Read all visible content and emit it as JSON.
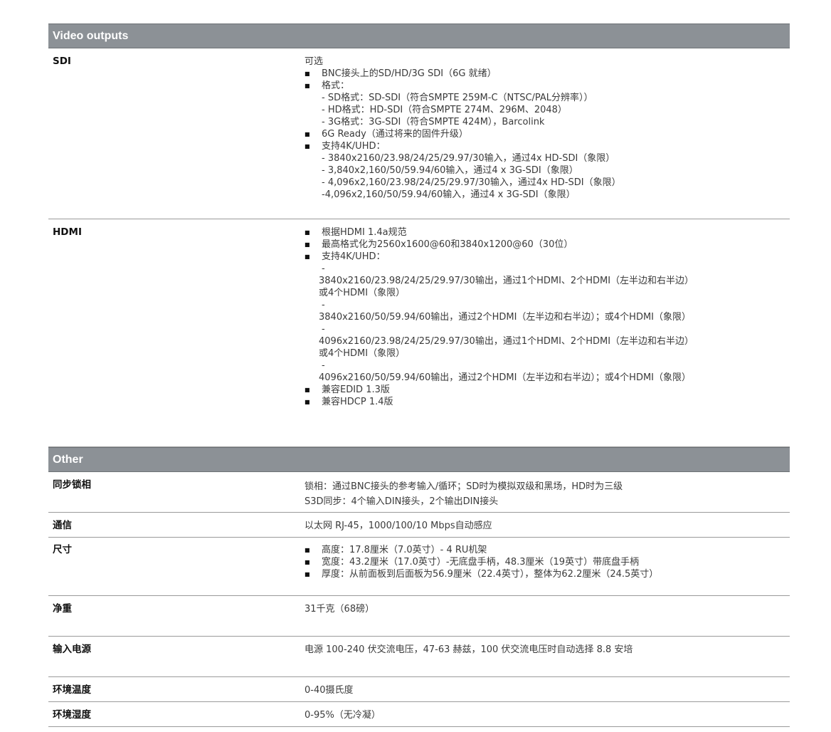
{
  "sections": {
    "video": {
      "title": "Video outputs"
    },
    "other": {
      "title": "Other"
    }
  },
  "sdi": {
    "label": "SDI",
    "intro": "可选",
    "items": [
      "BNC接头上的SD/HD/3G SDI（6G 就绪）",
      "格式：",
      "6G Ready（通过将来的固件升级）",
      "支持4K/UHD："
    ],
    "format_lines": [
      "- SD格式：SD-SDI（符合SMPTE 259M-C（NTSC/PAL分辨率））",
      "- HD格式：HD-SDI（符合SMPTE 274M、296M、2048）",
      "- 3G格式：3G-SDI（符合SMPTE 424M），Barcolink"
    ],
    "uhd_lines": [
      "- 3840x2160/23.98/24/25/29.97/30输入，通过4x HD-SDI（象限）",
      "- 3,840x2,160/50/59.94/60输入，通过4 x 3G-SDI（象限）",
      "- 4,096x2,160/23.98/24/25/29.97/30输入，通过4x HD-SDI（象限）",
      "-4,096x2,160/50/59.94/60输入，通过4 x 3G-SDI（象限）"
    ]
  },
  "hdmi": {
    "label": "HDMI",
    "items": [
      "根据HDMI 1.4a规范",
      "最高格式化为2560x1600@60和3840x1200@60（30位）",
      "支持4K/UHD：",
      "兼容EDID 1.3版",
      "兼容HDCP 1.4版"
    ],
    "dash": "-",
    "uhd_lines": [
      "3840x2160/23.98/24/25/29.97/30输出，通过1个HDMI、2个HDMI（左半边和右半边）或4个HDMI（象限）",
      "3840x2160/50/59.94/60输出，通过2个HDMI（左半边和右半边）；或4个HDMI（象限）",
      "4096x2160/23.98/24/25/29.97/30输出，通过1个HDMI、2个HDMI（左半边和右半边）或4个HDMI（象限）",
      "4096x2160/50/59.94/60输出，通过2个HDMI（左半边和右半边）；或4个HDMI（象限）"
    ]
  },
  "genlock": {
    "label": "同步锁相",
    "lines": [
      "锁相：通过BNC接头的参考输入/循环；SD时为模拟双级和黑场，HD时为三级",
      "S3D同步：4个输入DIN接头，2个输出DIN接头"
    ]
  },
  "comm": {
    "label": "通信",
    "value": "以太网 RJ-45，1000/100/10 Mbps自动感应"
  },
  "dimensions": {
    "label": "尺寸",
    "items": [
      "高度：17.8厘米（7.0英寸）- 4 RU机架",
      "宽度：43.2厘米（17.0英寸）-无底盘手柄，48.3厘米（19英寸）带底盘手柄",
      "厚度：从前面板到后面板为56.9厘米（22.4英寸），整体为62.2厘米（24.5英寸）"
    ]
  },
  "weight": {
    "label": "净重",
    "value": "31千克（68磅）"
  },
  "power": {
    "label": "输入电源",
    "value": "电源 100-240 伏交流电压，47-63 赫兹，100 伏交流电压时自动选择 8.8 安培"
  },
  "temp": {
    "label": "环境温度",
    "value": "0-40摄氏度"
  },
  "humidity": {
    "label": "环境湿度",
    "value": "0-95%（无冷凝）"
  },
  "bullet_glyph": "■"
}
